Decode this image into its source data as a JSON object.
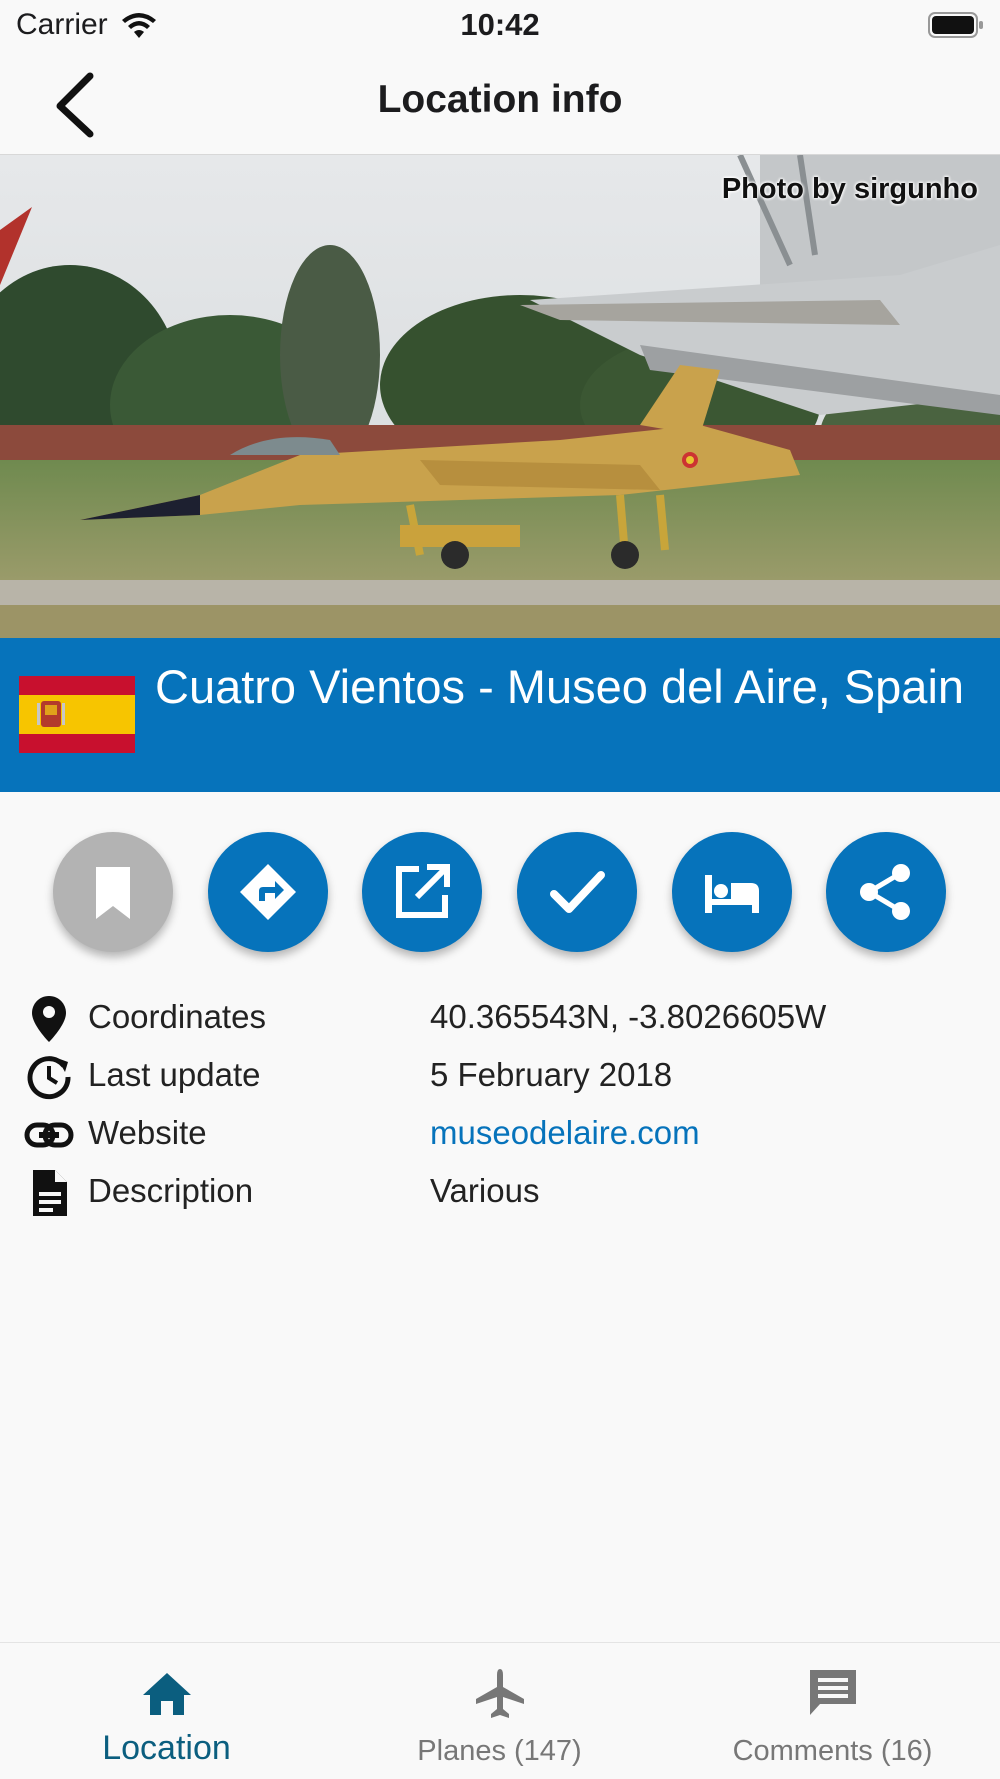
{
  "status_bar": {
    "carrier": "Carrier",
    "time": "10:42"
  },
  "nav": {
    "title": "Location info",
    "back_icon": "chevron-left-icon"
  },
  "photo": {
    "credit": "Photo by sirgunho"
  },
  "location": {
    "title": "Cuatro Vientos - Museo del Aire, Spain",
    "flag": "spain-flag"
  },
  "actions": [
    {
      "name": "bookmark",
      "icon": "bookmark-icon",
      "enabled": false
    },
    {
      "name": "directions",
      "icon": "directions-icon",
      "enabled": true
    },
    {
      "name": "open-external",
      "icon": "open-external-icon",
      "enabled": true
    },
    {
      "name": "visited",
      "icon": "checkmark-icon",
      "enabled": true
    },
    {
      "name": "hotel",
      "icon": "bed-icon",
      "enabled": true
    },
    {
      "name": "share",
      "icon": "share-icon",
      "enabled": true
    }
  ],
  "info": {
    "coordinates": {
      "label": "Coordinates",
      "value": "40.365543N, -3.8026605W"
    },
    "last_update": {
      "label": "Last update",
      "value": "5 February 2018"
    },
    "website": {
      "label": "Website",
      "value": "museodelaire.com"
    },
    "description": {
      "label": "Description",
      "value": "Various"
    }
  },
  "tabs": [
    {
      "label": "Location",
      "icon": "home-icon",
      "active": true
    },
    {
      "label": "Planes (147)",
      "icon": "airplane-icon",
      "active": false
    },
    {
      "label": "Comments (16)",
      "icon": "comment-icon",
      "active": false
    }
  ],
  "colors": {
    "accent": "#0673bb",
    "disabled": "#b3b3b3",
    "active_tab": "#0b5e7f"
  }
}
